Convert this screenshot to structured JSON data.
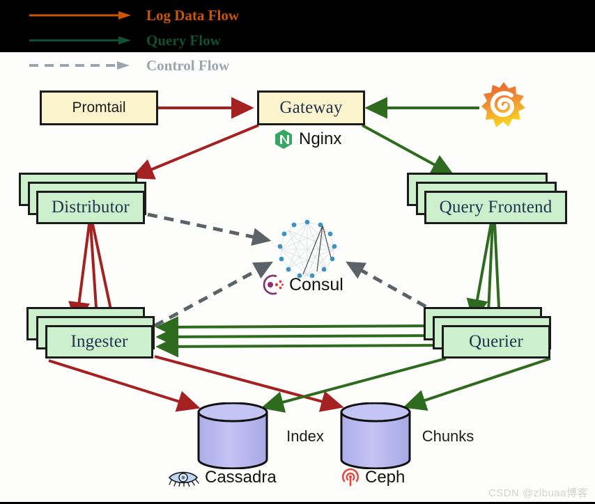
{
  "legend": {
    "items": [
      {
        "label": "Log Data Flow",
        "color": "#CC5500",
        "style": "solid"
      },
      {
        "label": "Query Flow",
        "color": "#0F5132",
        "style": "solid"
      },
      {
        "label": "Control Flow",
        "color": "#9aa5ad",
        "style": "dashed"
      }
    ]
  },
  "nodes": {
    "promtail": {
      "label": "Promtail"
    },
    "gateway": {
      "label": "Gateway"
    },
    "distributor": {
      "label": "Distributor"
    },
    "query_frontend": {
      "label": "Query Frontend"
    },
    "ingester": {
      "label": "Ingester"
    },
    "querier": {
      "label": "Querier"
    },
    "index": {
      "label": "Index"
    },
    "chunks": {
      "label": "Chunks"
    }
  },
  "captions": {
    "nginx": {
      "label": "Nginx",
      "icon": "nginx-icon"
    },
    "consul": {
      "label": "Consul",
      "icon": "consul-icon"
    },
    "cassadra": {
      "label": "Cassadra",
      "icon": "cassandra-eye-icon"
    },
    "ceph": {
      "label": "Ceph",
      "icon": "ceph-icon"
    }
  },
  "logos": {
    "grafana": {
      "icon": "grafana-logo"
    }
  },
  "colors": {
    "log_flow": "#A52121",
    "query_flow": "#2E6B1E",
    "control_flow": "#5b6268",
    "node_green": "#cdf0cc",
    "node_yellow": "#fbf4cd",
    "cylinder": "#b6b6ee",
    "node_border": "#1b1b1b"
  },
  "watermark": {
    "text": "CSDN @zlbuaa博客"
  }
}
